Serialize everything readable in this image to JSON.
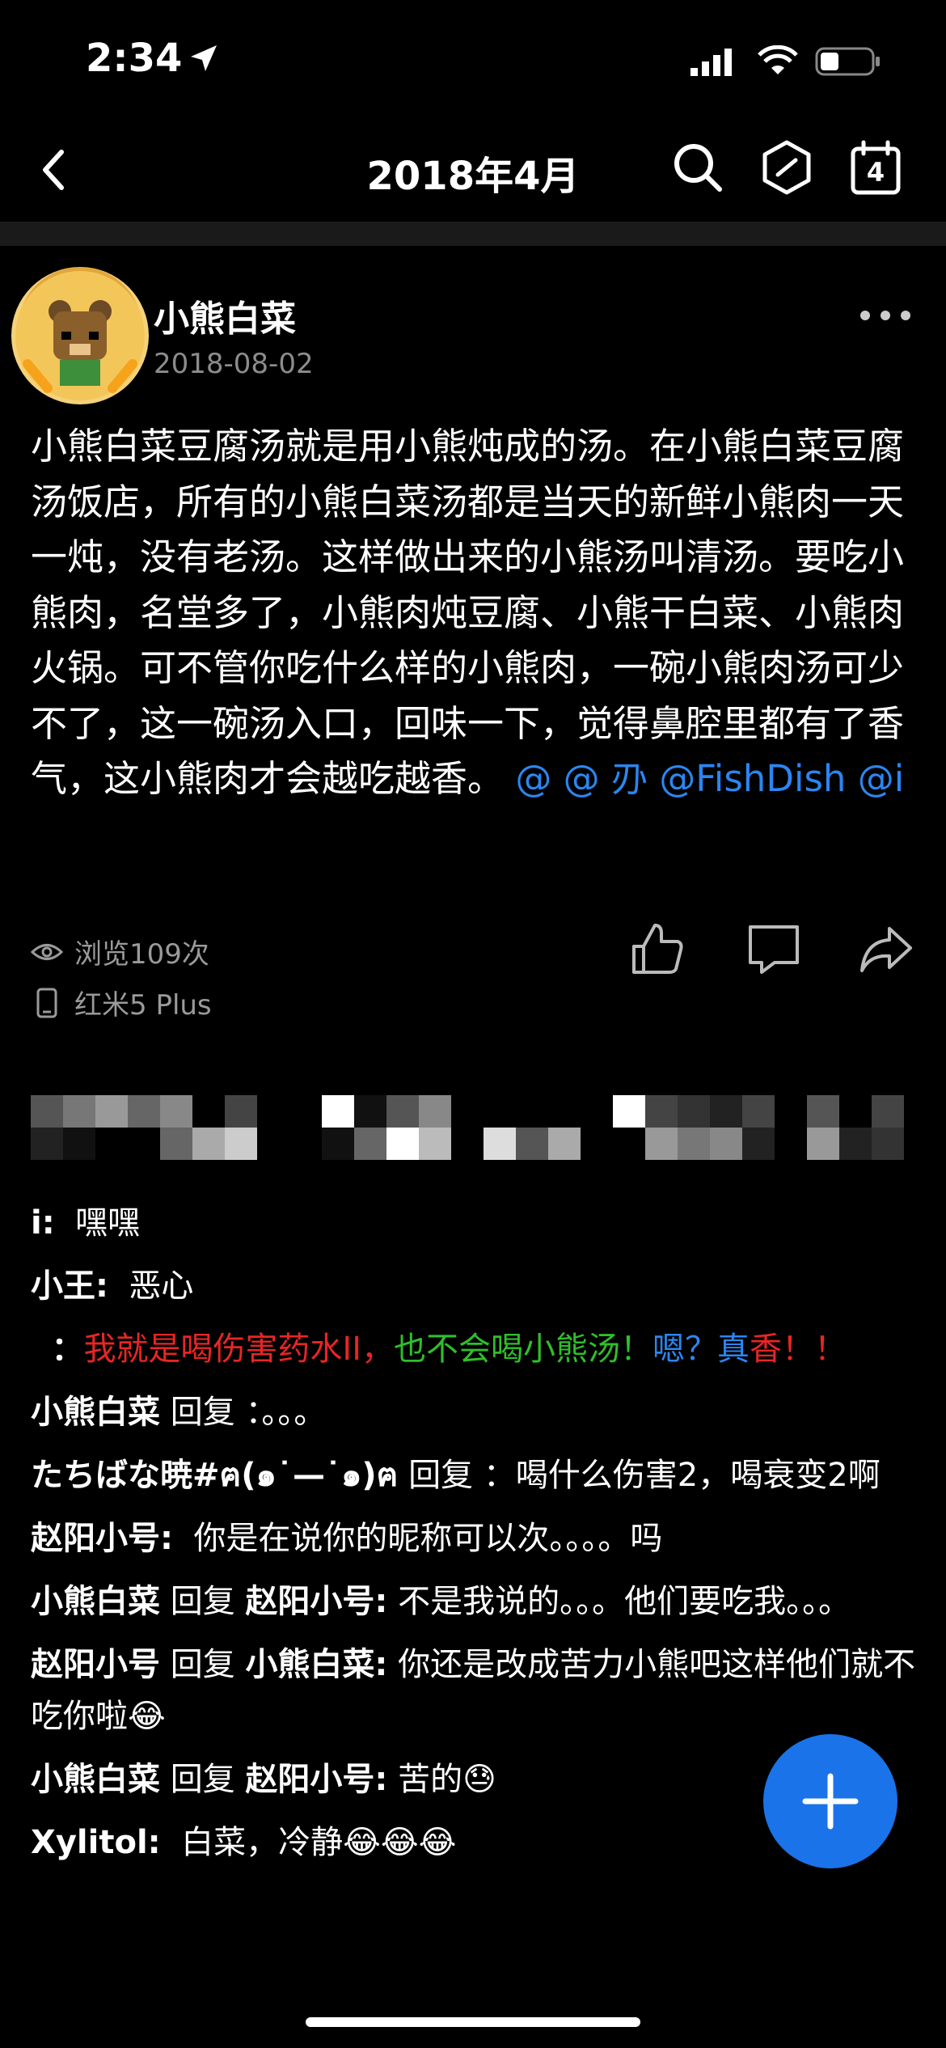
{
  "status_bar": {
    "time": "2:34",
    "battery_level": 0.35
  },
  "nav": {
    "title": "2018年4月",
    "calendar_day": "4"
  },
  "post": {
    "author": "小熊白菜",
    "date": "2018-08-02",
    "body": "小熊白菜豆腐汤就是用小熊炖成的汤。在小熊白菜豆腐汤饭店，所有的小熊白菜汤都是当天的新鲜小熊肉一天一炖，没有老汤。这样做出来的小熊汤叫清汤。要吃小熊肉，名堂多了，小熊肉炖豆腐、小熊干白菜、小熊肉火锅。可不管你吃什么样的小熊肉，一碗小熊肉汤可少不了，这一碗汤入口，回味一下，觉得鼻腔里都有了香气，这小熊肉才会越吃越香。",
    "mentions": "@    @ 刅 @FishDish @i",
    "views": "浏览109次",
    "device": "红米5 Plus"
  },
  "comments": [
    {
      "name": "i:",
      "text": "嘿嘿"
    },
    {
      "name": "小王:",
      "text": "恶心"
    },
    {
      "name": "：",
      "rainbow": [
        {
          "t": "我就是喝伤害药水II，",
          "c": "#e82525"
        },
        {
          "t": "也不会喝小熊汤！",
          "c": "#2fbf2a"
        },
        {
          "t": "嗯？真",
          "c": "#2b86f0"
        },
        {
          "t": "香！！",
          "c": "#e82525"
        }
      ]
    },
    {
      "name": "小熊白菜",
      "reply": "回复",
      "target": "",
      "text": "：。。。"
    },
    {
      "name": "たちばな暁#ฅ(๑˙—˙๑)ฅ",
      "reply": "回复",
      "target": "",
      "text": "：喝什么伤害2，喝衰变2啊"
    },
    {
      "name": "赵阳小号:",
      "text": "你是在说你的昵称可以次。。。。吗"
    },
    {
      "name": "小熊白菜",
      "reply": "回复",
      "target": "赵阳小号:",
      "text": "不是我说的。。。他们要吃我。。。"
    },
    {
      "name": "赵阳小号",
      "reply": "回复",
      "target": "小熊白菜:",
      "text": "你还是改成苦力小熊吧这样他们就不吃你啦😂"
    },
    {
      "name": "小熊白菜",
      "reply": "回复",
      "target": "赵阳小号:",
      "text": "苦的😓"
    },
    {
      "name": "Xylitol:",
      "text": "白菜，冷静😂😂😂"
    }
  ],
  "colors": {
    "accent": "#1a73e8",
    "mention": "#2b86f0",
    "muted": "#8c8c8c"
  }
}
